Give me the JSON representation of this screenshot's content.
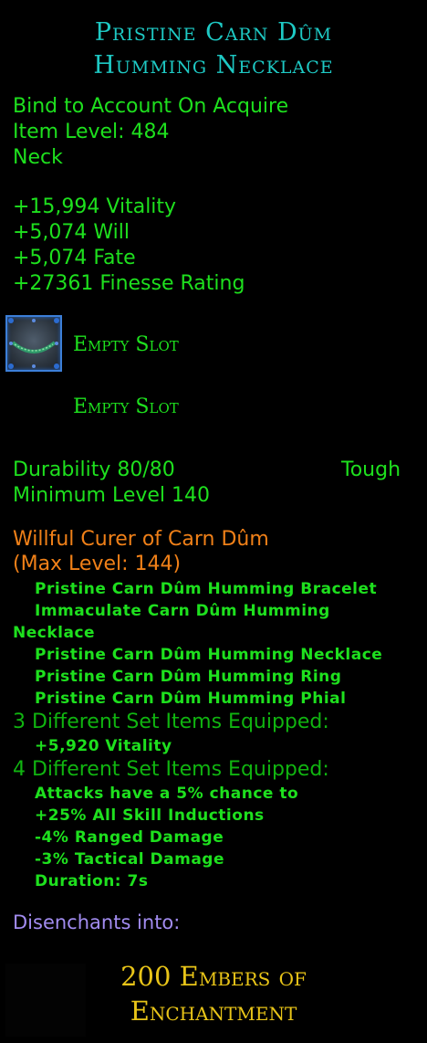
{
  "item": {
    "title_line1": "Pristine Carn Dûm",
    "title_line2": "Humming Necklace",
    "binding": "Bind to Account On Acquire",
    "item_level": "Item Level: 484",
    "slot": "Neck"
  },
  "stats": [
    "+15,994 Vitality",
    "+5,074 Will",
    "+5,074 Fate",
    "+27361 Finesse Rating"
  ],
  "essence_slots": [
    {
      "label": "Empty Slot",
      "icon": "essence-socket-icon"
    },
    {
      "label": "Empty Slot"
    }
  ],
  "durability": {
    "text": "Durability 80/80",
    "type": "Tough",
    "min_level": "Minimum Level 140"
  },
  "set": {
    "name": "Willful Curer of Carn Dûm",
    "max_level": "(Max Level: 144)",
    "items": [
      "Pristine Carn Dûm Humming Bracelet",
      "Immaculate Carn Dûm Humming",
      "Necklace",
      "Pristine Carn Dûm Humming Necklace",
      "Pristine Carn Dûm Humming Ring",
      "Pristine Carn Dûm Humming Phial"
    ],
    "bonus3_header": "3 Different Set Items Equipped:",
    "bonus3": [
      "+5,920 Vitality"
    ],
    "bonus4_header": "4 Different Set Items Equipped:",
    "bonus4": [
      "Attacks have a 5% chance to",
      "+25% All Skill Inductions",
      "-4% Ranged Damage",
      "-3% Tactical Damage",
      "Duration: 7s"
    ]
  },
  "disenchant": {
    "label": "Disenchants into:",
    "line1": "200 Embers of",
    "line2": "Enchantment"
  },
  "colors": {
    "title": "#1ec9c4",
    "green": "#1ee01e",
    "set_name": "#f08018",
    "disenchant": "#a28cf0",
    "reward": "#e8c418",
    "socket_border": "#3c7fd8"
  }
}
